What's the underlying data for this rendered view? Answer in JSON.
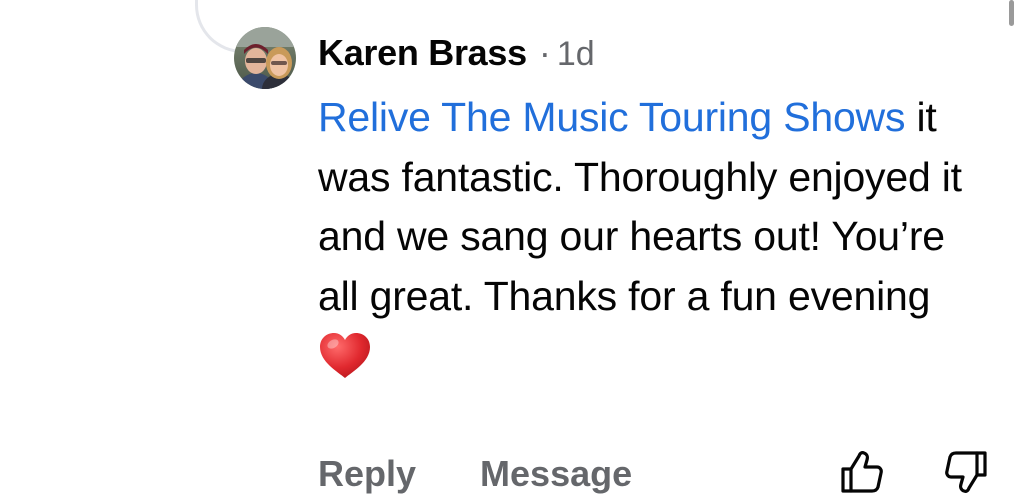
{
  "comment": {
    "author": "Karen Brass",
    "separator": "·",
    "timestamp": "1d",
    "mention": "Relive The Music Touring Shows",
    "text": " it was fantastic. Thoroughly enjoyed it and we sang our hearts out! You’re all great. Thanks for a fun evening",
    "emoji_icon": "red-heart-emoji"
  },
  "actions": {
    "reply_label": "Reply",
    "message_label": "Message",
    "upvote_icon": "thumbs-up-icon",
    "downvote_icon": "thumbs-down-icon"
  },
  "colors": {
    "mention": "#216fdb",
    "secondary_text": "#65676b",
    "primary_text": "#050505",
    "thread_line": "#e4e6eb",
    "heart": "#e0282e"
  }
}
